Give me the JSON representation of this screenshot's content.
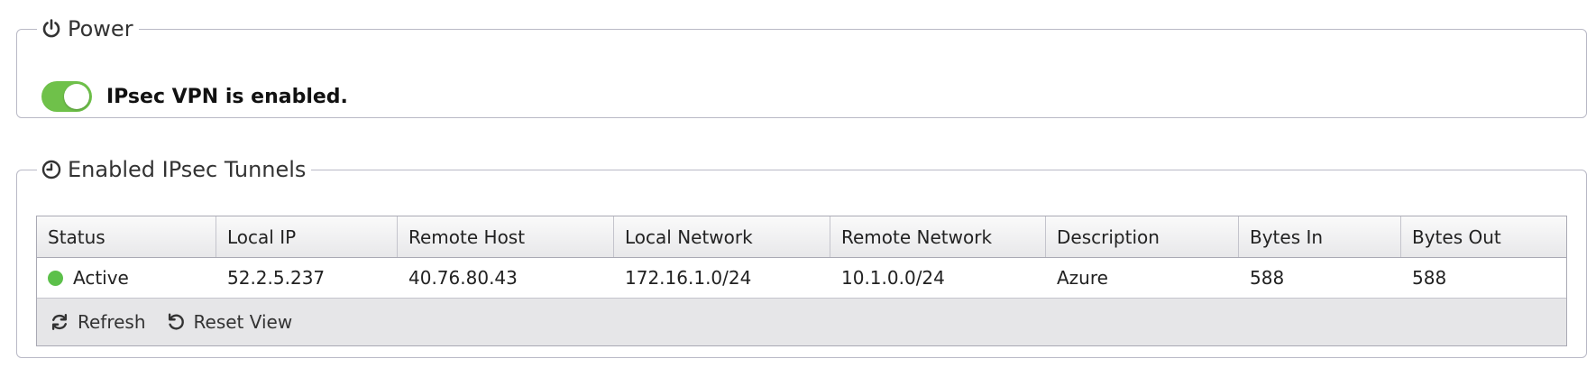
{
  "power": {
    "legend": "Power",
    "status_text": "IPsec VPN is enabled.",
    "enabled": true
  },
  "tunnels": {
    "legend": "Enabled IPsec Tunnels",
    "columns": [
      "Status",
      "Local IP",
      "Remote Host",
      "Local Network",
      "Remote Network",
      "Description",
      "Bytes In",
      "Bytes Out"
    ],
    "rows": [
      {
        "status": "Active",
        "local_ip": "52.2.5.237",
        "remote_host": "40.76.80.43",
        "local_network": "172.16.1.0/24",
        "remote_network": "10.1.0.0/24",
        "description": "Azure",
        "bytes_in": "588",
        "bytes_out": "588"
      }
    ],
    "toolbar": {
      "refresh_label": "Refresh",
      "reset_view_label": "Reset View"
    }
  },
  "colors": {
    "toggle_on": "#6fc14a",
    "status_active": "#5cc04a",
    "panel_border": "#b9b9c6"
  },
  "icons": {
    "power_legend": "power-icon",
    "tunnels_legend": "clock-icon",
    "refresh": "refresh-icon",
    "reset_view": "undo-icon"
  }
}
